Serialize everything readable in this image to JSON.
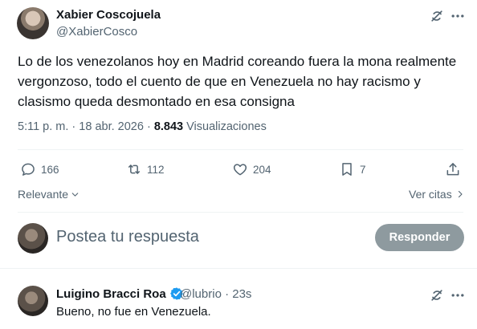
{
  "tweet": {
    "author_name": "Xabier Coscojuela",
    "author_handle": "@XabierCosco",
    "text": "Lo de los venezolanos hoy en Madrid coreando fuera la mona realmente vergonzoso, todo el cuento de que en Venezuela no hay racismo y clasismo queda desmontado en esa consigna",
    "time": "5:11 p. m. · 18 abr. 2026 · ",
    "views_count": "8.843",
    "views_label": " Visualizaciones",
    "actions": {
      "reply_count": "166",
      "retweet_count": "112",
      "like_count": "204",
      "bookmark_count": "7"
    }
  },
  "sort": {
    "label": "Relevante",
    "quotes_label": "Ver citas"
  },
  "compose": {
    "placeholder": "Postea tu respuesta",
    "button_label": "Responder"
  },
  "reply": {
    "author_name": "Luigino Bracci Roa",
    "meta": "@lubrio · 23s",
    "text": "Bueno, no fue en Venezuela."
  },
  "colors": {
    "text": "#0f1419",
    "secondary": "#536471",
    "verified": "#1d9bf0",
    "button_disabled": "#8e9a9f"
  },
  "icons": [
    "grok-icon",
    "more-icon",
    "reply-icon",
    "retweet-icon",
    "like-icon",
    "bookmark-icon",
    "share-icon",
    "chevron-down-icon",
    "chevron-right-icon",
    "verified-badge-icon"
  ]
}
